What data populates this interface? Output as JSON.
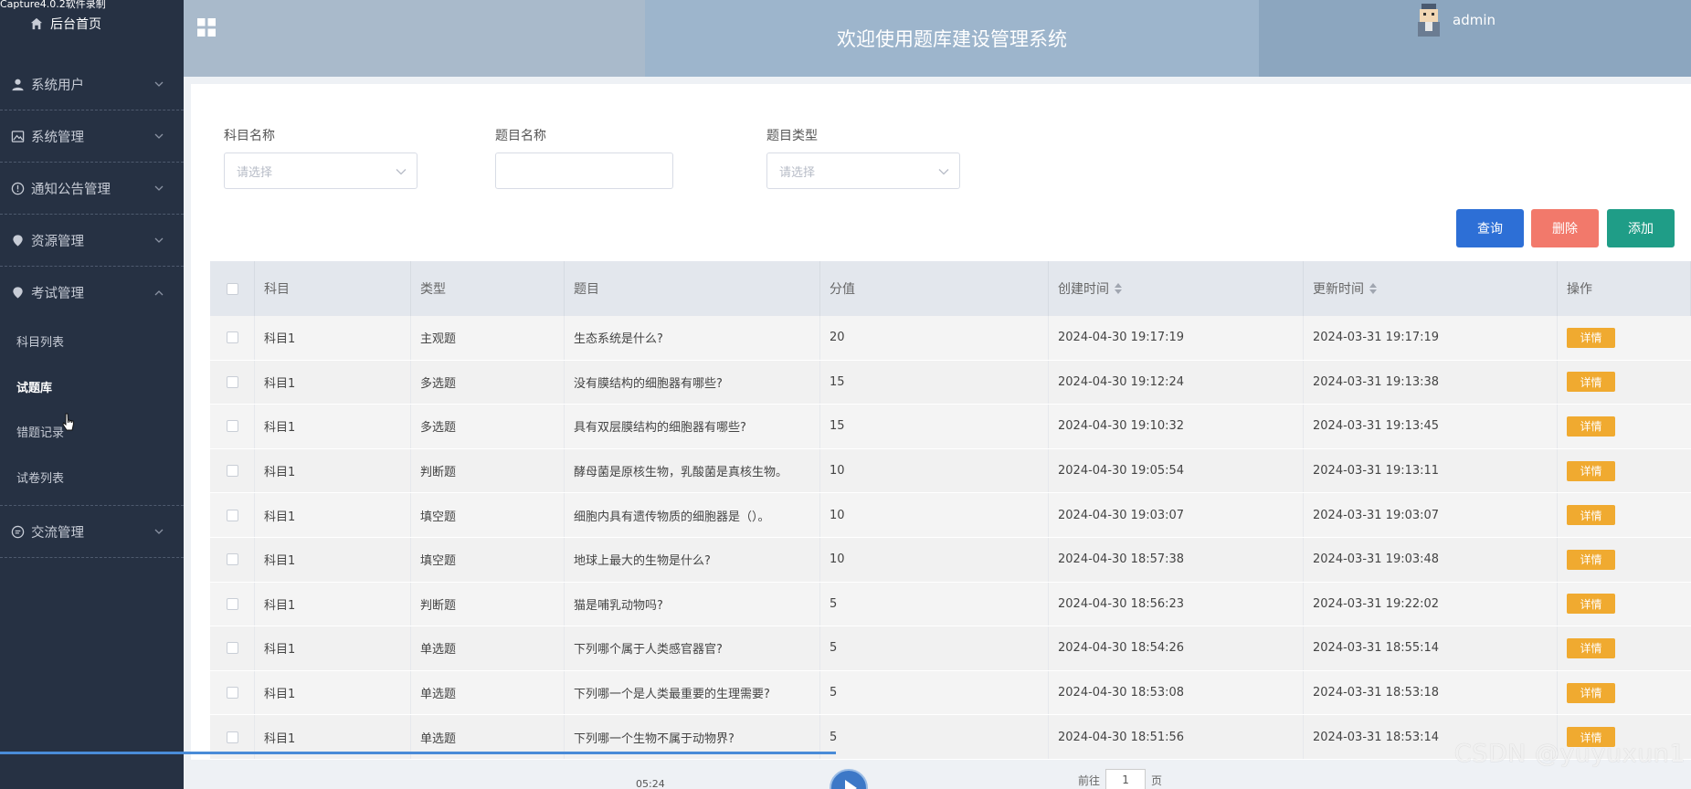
{
  "capture_title": "Capture4.0.2软件录制",
  "sidebar": {
    "home_label": "后台首页",
    "menus": [
      {
        "label": "系统用户",
        "icon": "user-icon"
      },
      {
        "label": "系统管理",
        "icon": "image-icon"
      },
      {
        "label": "通知公告管理",
        "icon": "info-circle-icon"
      },
      {
        "label": "资源管理",
        "icon": "location-icon"
      },
      {
        "label": "考试管理",
        "icon": "location-icon",
        "expanded": true,
        "children": [
          "科目列表",
          "试题库",
          "错题记录",
          "试卷列表"
        ],
        "active_child": "试题库"
      },
      {
        "label": "交流管理",
        "icon": "chat-icon"
      }
    ]
  },
  "header": {
    "title": "欢迎使用题库建设管理系统",
    "username": "admin"
  },
  "filters": {
    "subject_label": "科目名称",
    "subject_placeholder": "请选择",
    "question_label": "题目名称",
    "question_value": "",
    "type_label": "题目类型",
    "type_placeholder": "请选择"
  },
  "buttons": {
    "search": "查询",
    "delete": "删除",
    "add": "添加"
  },
  "colors": {
    "search_btn": "#2d6fd6",
    "delete_btn": "#f2796b",
    "add_btn": "#1f9d87",
    "detail_btn": "#f0aa30",
    "sidebar_bg": "#263143"
  },
  "table": {
    "columns": [
      "科目",
      "类型",
      "题目",
      "分值",
      "创建时间",
      "更新时间",
      "操作"
    ],
    "detail_label": "详情",
    "rows": [
      {
        "subject": "科目1",
        "type": "主观题",
        "question": "生态系统是什么?",
        "score": "20",
        "created": "2024-04-30 19:17:19",
        "updated": "2024-03-31 19:17:19"
      },
      {
        "subject": "科目1",
        "type": "多选题",
        "question": "没有膜结构的细胞器有哪些?",
        "score": "15",
        "created": "2024-04-30 19:12:24",
        "updated": "2024-03-31 19:13:38"
      },
      {
        "subject": "科目1",
        "type": "多选题",
        "question": "具有双层膜结构的细胞器有哪些?",
        "score": "15",
        "created": "2024-04-30 19:10:32",
        "updated": "2024-03-31 19:13:45"
      },
      {
        "subject": "科目1",
        "type": "判断题",
        "question": "酵母菌是原核生物，乳酸菌是真核生物。",
        "score": "10",
        "created": "2024-04-30 19:05:54",
        "updated": "2024-03-31 19:13:11"
      },
      {
        "subject": "科目1",
        "type": "填空题",
        "question": "细胞内具有遗传物质的细胞器是（）。",
        "score": "10",
        "created": "2024-04-30 19:03:07",
        "updated": "2024-03-31 19:03:07"
      },
      {
        "subject": "科目1",
        "type": "填空题",
        "question": "地球上最大的生物是什么?",
        "score": "10",
        "created": "2024-04-30 18:57:38",
        "updated": "2024-03-31 19:03:48"
      },
      {
        "subject": "科目1",
        "type": "判断题",
        "question": "猫是哺乳动物吗?",
        "score": "5",
        "created": "2024-04-30 18:56:23",
        "updated": "2024-03-31 19:22:02"
      },
      {
        "subject": "科目1",
        "type": "单选题",
        "question": "下列哪个属于人类感官器官?",
        "score": "5",
        "created": "2024-04-30 18:54:26",
        "updated": "2024-03-31 18:55:14"
      },
      {
        "subject": "科目1",
        "type": "单选题",
        "question": "下列哪一个是人类最重要的生理需要?",
        "score": "5",
        "created": "2024-04-30 18:53:08",
        "updated": "2024-03-31 18:53:18"
      },
      {
        "subject": "科目1",
        "type": "单选题",
        "question": "下列哪一个生物不属于动物界?",
        "score": "5",
        "created": "2024-04-30 18:51:56",
        "updated": "2024-03-31 18:53:14"
      }
    ]
  },
  "player": {
    "time": "05:24",
    "goto_prefix": "前往",
    "goto_value": "1",
    "goto_suffix": "页"
  },
  "watermark": "CSDN @yuyuxun1"
}
